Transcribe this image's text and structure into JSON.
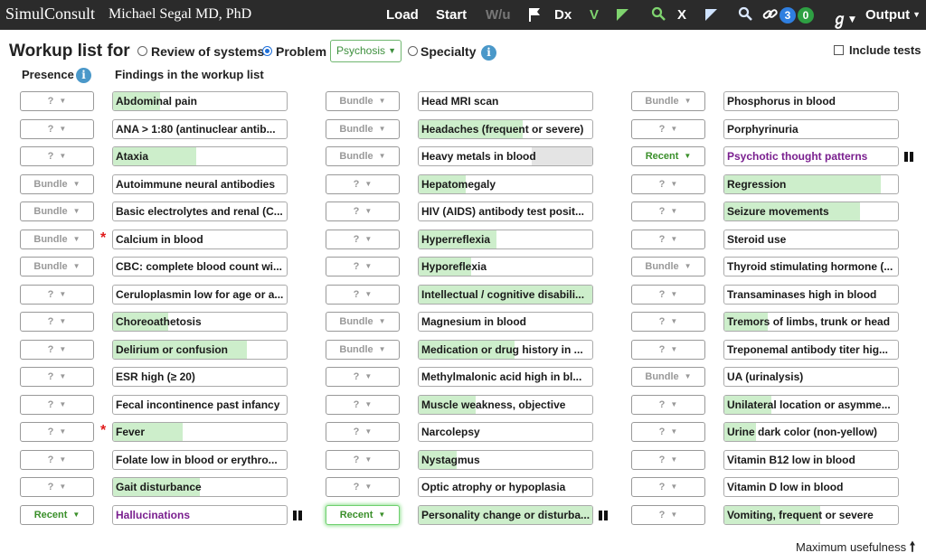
{
  "topbar": {
    "logo": "SimulConsult",
    "user": "Michael Segal MD, PhD",
    "nav": {
      "load": "Load",
      "start": "Start",
      "wu": "W/u",
      "dx": "Dx",
      "v": "V",
      "x": "X",
      "badge_blue": "3",
      "badge_green": "0",
      "output": "Output"
    },
    "colors": {
      "bar": "#2b2b2b",
      "green": "#7fd46f",
      "blue_badge": "#2f7fe0",
      "green_badge": "#2ea043"
    }
  },
  "header": {
    "title": "Workup list for",
    "options": [
      "Review of systems",
      "Problem",
      "Specialty"
    ],
    "selected_option": "Problem",
    "problem_value": "Psychosis",
    "include_tests": "Include tests",
    "presence_label": "Presence",
    "findings_label": "Findings in the workup list"
  },
  "columns": [
    [
      {
        "presence": "?",
        "finding": "Abdominal pain",
        "fill": 0.27
      },
      {
        "presence": "?",
        "finding": "ANA > 1:80 (antinuclear antib...",
        "fill": 0
      },
      {
        "presence": "?",
        "finding": "Ataxia",
        "fill": 0.48
      },
      {
        "presence": "Bundle",
        "finding": "Autoimmune neural antibodies",
        "fill": 0
      },
      {
        "presence": "Bundle",
        "finding": "Basic electrolytes and renal (C...",
        "fill": 0
      },
      {
        "presence": "Bundle",
        "finding": "Calcium in blood",
        "fill": 0,
        "star": true
      },
      {
        "presence": "Bundle",
        "finding": "CBC: complete blood count wi...",
        "fill": 0
      },
      {
        "presence": "?",
        "finding": "Ceruloplasmin low for age or a...",
        "fill": 0
      },
      {
        "presence": "?",
        "finding": "Choreoathetosis",
        "fill": 0.32
      },
      {
        "presence": "?",
        "finding": "Delirium or confusion",
        "fill": 0.77
      },
      {
        "presence": "?",
        "finding": "ESR high (≥ 20)",
        "fill": 0
      },
      {
        "presence": "?",
        "finding": "Fecal incontinence past infancy",
        "fill": 0
      },
      {
        "presence": "?",
        "finding": "Fever",
        "fill": 0.4,
        "star": true
      },
      {
        "presence": "?",
        "finding": "Folate low in blood or erythro...",
        "fill": 0
      },
      {
        "presence": "?",
        "finding": "Gait disturbance",
        "fill": 0.5
      },
      {
        "presence": "Recent",
        "finding": "Hallucinations",
        "fill": 0,
        "purple": true,
        "pause": true
      }
    ],
    [
      {
        "presence": "Bundle",
        "finding": "Head MRI scan",
        "fill": 0
      },
      {
        "presence": "Bundle",
        "finding": "Headaches (frequent or severe)",
        "fill": 0.6
      },
      {
        "presence": "Bundle",
        "finding": "Heavy metals in blood",
        "fill": 0,
        "grayfill": 0.35
      },
      {
        "presence": "?",
        "finding": "Hepatomegaly",
        "fill": 0.27
      },
      {
        "presence": "?",
        "finding": "HIV (AIDS) antibody test posit...",
        "fill": 0
      },
      {
        "presence": "?",
        "finding": "Hyperreflexia",
        "fill": 0.45
      },
      {
        "presence": "?",
        "finding": "Hyporeflexia",
        "fill": 0.3
      },
      {
        "presence": "?",
        "finding": "Intellectual / cognitive disabili...",
        "fill": 1
      },
      {
        "presence": "Bundle",
        "finding": "Magnesium in blood",
        "fill": 0
      },
      {
        "presence": "Bundle",
        "finding": "Medication or drug history in ...",
        "fill": 0.55
      },
      {
        "presence": "?",
        "finding": "Methylmalonic acid high in bl...",
        "fill": 0
      },
      {
        "presence": "?",
        "finding": "Muscle weakness, objective",
        "fill": 0.33
      },
      {
        "presence": "?",
        "finding": "Narcolepsy",
        "fill": 0
      },
      {
        "presence": "?",
        "finding": "Nystagmus",
        "fill": 0.22
      },
      {
        "presence": "?",
        "finding": "Optic atrophy or hypoplasia",
        "fill": 0
      },
      {
        "presence": "Recent",
        "finding": "Personality change or disturba...",
        "fill": 1,
        "glow": true,
        "pause": true
      }
    ],
    [
      {
        "presence": "Bundle",
        "finding": "Phosphorus in blood",
        "fill": 0
      },
      {
        "presence": "?",
        "finding": "Porphyrinuria",
        "fill": 0
      },
      {
        "presence": "Recent",
        "finding": "Psychotic thought patterns",
        "fill": 0,
        "purple": true,
        "pause": true
      },
      {
        "presence": "?",
        "finding": "Regression",
        "fill": 0.9
      },
      {
        "presence": "?",
        "finding": "Seizure movements",
        "fill": 0.78
      },
      {
        "presence": "?",
        "finding": "Steroid use",
        "fill": 0
      },
      {
        "presence": "Bundle",
        "finding": "Thyroid stimulating hormone (...",
        "fill": 0
      },
      {
        "presence": "?",
        "finding": "Transaminases high in blood",
        "fill": 0
      },
      {
        "presence": "?",
        "finding": "Tremors of limbs, trunk or head",
        "fill": 0.25
      },
      {
        "presence": "?",
        "finding": "Treponemal antibody titer hig...",
        "fill": 0
      },
      {
        "presence": "Bundle",
        "finding": "UA (urinalysis)",
        "fill": 0
      },
      {
        "presence": "?",
        "finding": "Unilateral location or asymme...",
        "fill": 0.27
      },
      {
        "presence": "?",
        "finding": "Urine dark color (non-yellow)",
        "fill": 0.18
      },
      {
        "presence": "?",
        "finding": "Vitamin B12 low in blood",
        "fill": 0
      },
      {
        "presence": "?",
        "finding": "Vitamin D low in blood",
        "fill": 0
      },
      {
        "presence": "?",
        "finding": "Vomiting, frequent or severe",
        "fill": 0.55
      }
    ]
  ],
  "footer": {
    "max_usefulness": "Maximum usefulness"
  }
}
